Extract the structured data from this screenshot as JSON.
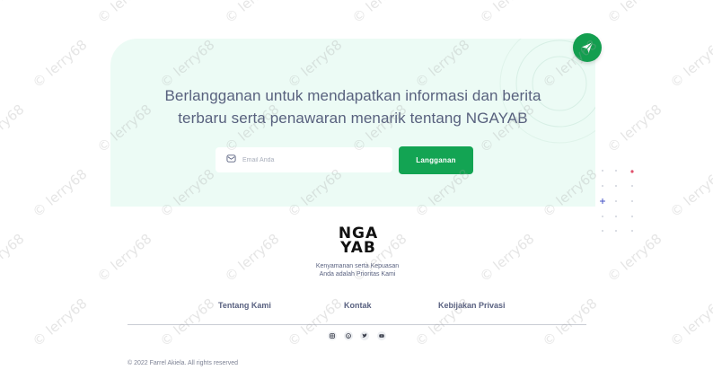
{
  "subscribe": {
    "headline_line1": "Berlangganan untuk mendapatkan informasi dan berita",
    "headline_line2": "terbaru serta penawaran menarik tentang NGAYAB",
    "email_placeholder": "Email Anda",
    "email_value": "",
    "button_label": "Langganan",
    "icons": {
      "email": "mail-icon",
      "badge": "paper-plane-icon"
    }
  },
  "brand": {
    "logo_line1": "NGA",
    "logo_line2": "YAB",
    "tagline_line1": "Kenyamanan serta Kepuasan",
    "tagline_line2": "Anda adalah Prioritas Kami"
  },
  "footer": {
    "links": [
      "Tentang Kami",
      "Kontak",
      "Kebijakan Privasi"
    ],
    "social_icons": [
      "instagram-icon",
      "pinterest-icon",
      "twitter-icon",
      "youtube-icon"
    ],
    "copyright": "© 2022 Farrel Akiela. All rights reserved"
  },
  "watermark": "© lerry68",
  "colors": {
    "accent_green": "#13a453",
    "card_background": "#ecfbf5",
    "heading_text": "#58617e"
  }
}
